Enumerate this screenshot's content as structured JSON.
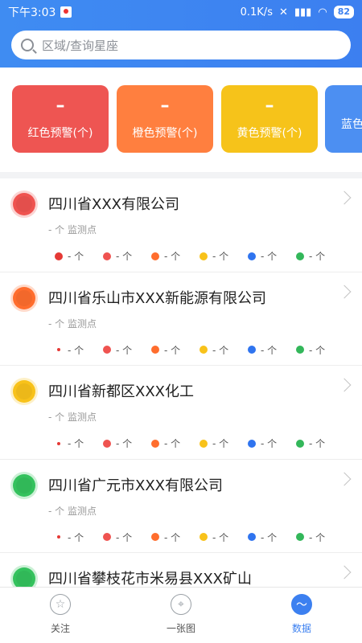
{
  "status": {
    "time": "下午3:03",
    "speed": "0.1K/s",
    "battery": "82"
  },
  "search": {
    "placeholder": "区域/查询星座"
  },
  "cards": [
    {
      "count": "–",
      "label": "红色预警(个)",
      "color": "#ee5552"
    },
    {
      "count": "–",
      "label": "橙色预警(个)",
      "color": "#ff7f3f"
    },
    {
      "count": "–",
      "label": "黄色预警(个)",
      "color": "#f6c31a"
    },
    {
      "count": "",
      "label": "蓝色",
      "color": "#4c8ff2"
    }
  ],
  "legend_colors": [
    "#e53935",
    "#ef5350",
    "#ff6d2d",
    "#f8c21a",
    "#2f74ef",
    "#33b75a"
  ],
  "list": [
    {
      "name": "四川省XXX有限公司",
      "sub": "- 个 监测点",
      "dot_color": "#ef5350",
      "first_dot_small": false,
      "counts": [
        "- 个",
        "- 个",
        "- 个",
        "- 个",
        "- 个",
        "- 个"
      ]
    },
    {
      "name": "四川省乐山市XXX新能源有限公司",
      "sub": "- 个 监测点",
      "dot_color": "#ff6d2d",
      "first_dot_small": true,
      "counts": [
        "- 个",
        "- 个",
        "- 个",
        "- 个",
        "- 个",
        "- 个"
      ]
    },
    {
      "name": "四川省新都区XXX化工",
      "sub": "- 个 监测点",
      "dot_color": "#f8c21a",
      "first_dot_small": true,
      "counts": [
        "- 个",
        "- 个",
        "- 个",
        "- 个",
        "- 个",
        "- 个"
      ]
    },
    {
      "name": "四川省广元市XXX有限公司",
      "sub": "- 个 监测点",
      "dot_color": "#34c25d",
      "first_dot_small": true,
      "counts": [
        "- 个",
        "- 个",
        "- 个",
        "- 个",
        "- 个",
        "- 个"
      ]
    },
    {
      "name": "四川省攀枝花市米易县XXX矿山",
      "sub": "",
      "dot_color": "#34c25d",
      "first_dot_small": true,
      "counts": []
    }
  ],
  "tabs": [
    {
      "label": "关注",
      "icon": "star-icon",
      "active": false
    },
    {
      "label": "一张图",
      "icon": "location-pin-icon",
      "active": false
    },
    {
      "label": "数据",
      "icon": "wave-icon",
      "active": true
    }
  ]
}
